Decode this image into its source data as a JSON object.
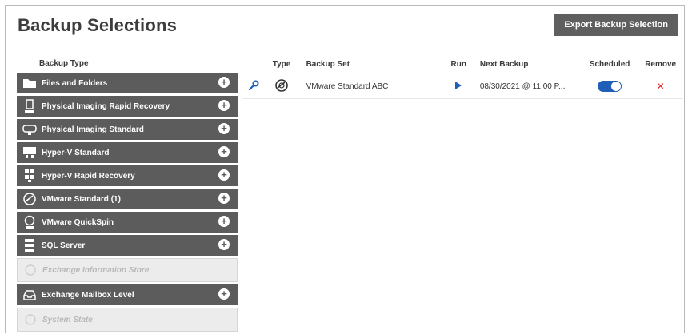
{
  "header": {
    "title": "Backup Selections",
    "export_label": "Export Backup Selection"
  },
  "left": {
    "heading": "Backup Type",
    "items": [
      {
        "label": "Files and Folders",
        "icon": "folder-icon",
        "disabled": false
      },
      {
        "label": "Physical Imaging Rapid Recovery",
        "icon": "server-rapid-icon",
        "disabled": false
      },
      {
        "label": "Physical Imaging Standard",
        "icon": "disk-image-icon",
        "disabled": false
      },
      {
        "label": "Hyper-V Standard",
        "icon": "hyperv-icon",
        "disabled": false
      },
      {
        "label": "Hyper-V Rapid Recovery",
        "icon": "hyperv-rapid-icon",
        "disabled": false
      },
      {
        "label": "VMware Standard (1)",
        "icon": "vmware-icon",
        "disabled": false
      },
      {
        "label": "VMware QuickSpin",
        "icon": "vmware-quickspin-icon",
        "disabled": false
      },
      {
        "label": "SQL Server",
        "icon": "database-icon",
        "disabled": false
      },
      {
        "label": "Exchange Information Store",
        "icon": "exchange-store-icon",
        "disabled": true
      },
      {
        "label": "Exchange Mailbox Level",
        "icon": "mailbox-icon",
        "disabled": false
      },
      {
        "label": "System State",
        "icon": "system-state-icon",
        "disabled": true
      }
    ]
  },
  "table": {
    "columns": {
      "type": "Type",
      "backup_set": "Backup Set",
      "run": "Run",
      "next_backup": "Next Backup",
      "scheduled": "Scheduled",
      "remove": "Remove"
    },
    "rows": [
      {
        "backup_set": "VMware Standard ABC",
        "next_backup": "08/30/2021 @ 11:00 P...",
        "scheduled": true
      }
    ]
  },
  "colors": {
    "panel_dark": "#5c5c5c",
    "accent_blue": "#1f5fb8",
    "remove_red": "#e02020"
  }
}
